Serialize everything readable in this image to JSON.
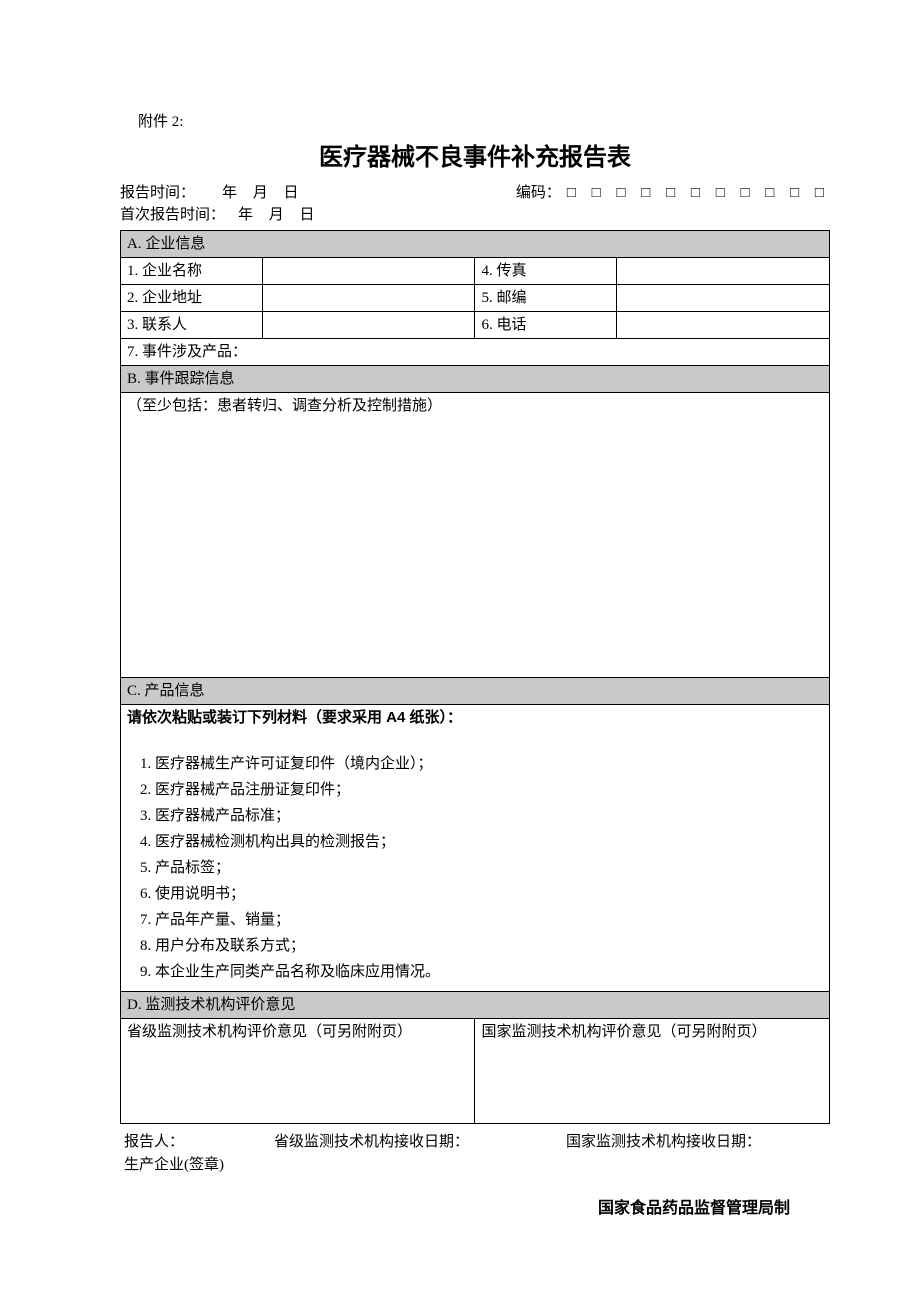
{
  "attachment_label": "附件 2:",
  "title": "医疗器械不良事件补充报告表",
  "header": {
    "report_time_label": "报告时间：",
    "first_report_time_label": "首次报告时间：",
    "year_label": "年",
    "month_label": "月",
    "day_label": "日",
    "code_label": "编码：",
    "code_boxes": "□ □ □ □ □ □ □ □ □ □ □"
  },
  "section_a": {
    "heading": "A.  企业信息",
    "row1_label": "1. 企业名称",
    "row2_label": "2. 企业地址",
    "row3_label": "3. 联系人",
    "row4_label": "4. 传真",
    "row5_label": "5. 邮编",
    "row6_label": "6. 电话",
    "row7_label": "7. 事件涉及产品："
  },
  "section_b": {
    "heading": "B. 事件跟踪信息",
    "note": "（至少包括：患者转归、调查分析及控制措施）"
  },
  "section_c": {
    "heading": "C. 产品信息",
    "instruction": "请依次粘贴或装订下列材料（要求采用 A4 纸张）：",
    "items": [
      "医疗器械生产许可证复印件（境内企业）；",
      "医疗器械产品注册证复印件；",
      "医疗器械产品标准；",
      "医疗器械检测机构出具的检测报告；",
      "产品标签；",
      "使用说明书；",
      "产品年产量、销量；",
      "用户分布及联系方式；",
      "本企业生产同类产品名称及临床应用情况。"
    ]
  },
  "section_d": {
    "heading": "D.  监测技术机构评价意见",
    "province_opinion": "省级监测技术机构评价意见（可另附附页）",
    "national_opinion": "国家监测技术机构评价意见（可另附附页）"
  },
  "signature": {
    "reporter_label": "报告人：",
    "province_receive_label": "省级监测技术机构接收日期：",
    "national_receive_label": "国家监测技术机构接收日期：",
    "enterprise_seal": "生产企业(签章)"
  },
  "authority": "国家食品药品监督管理局制"
}
